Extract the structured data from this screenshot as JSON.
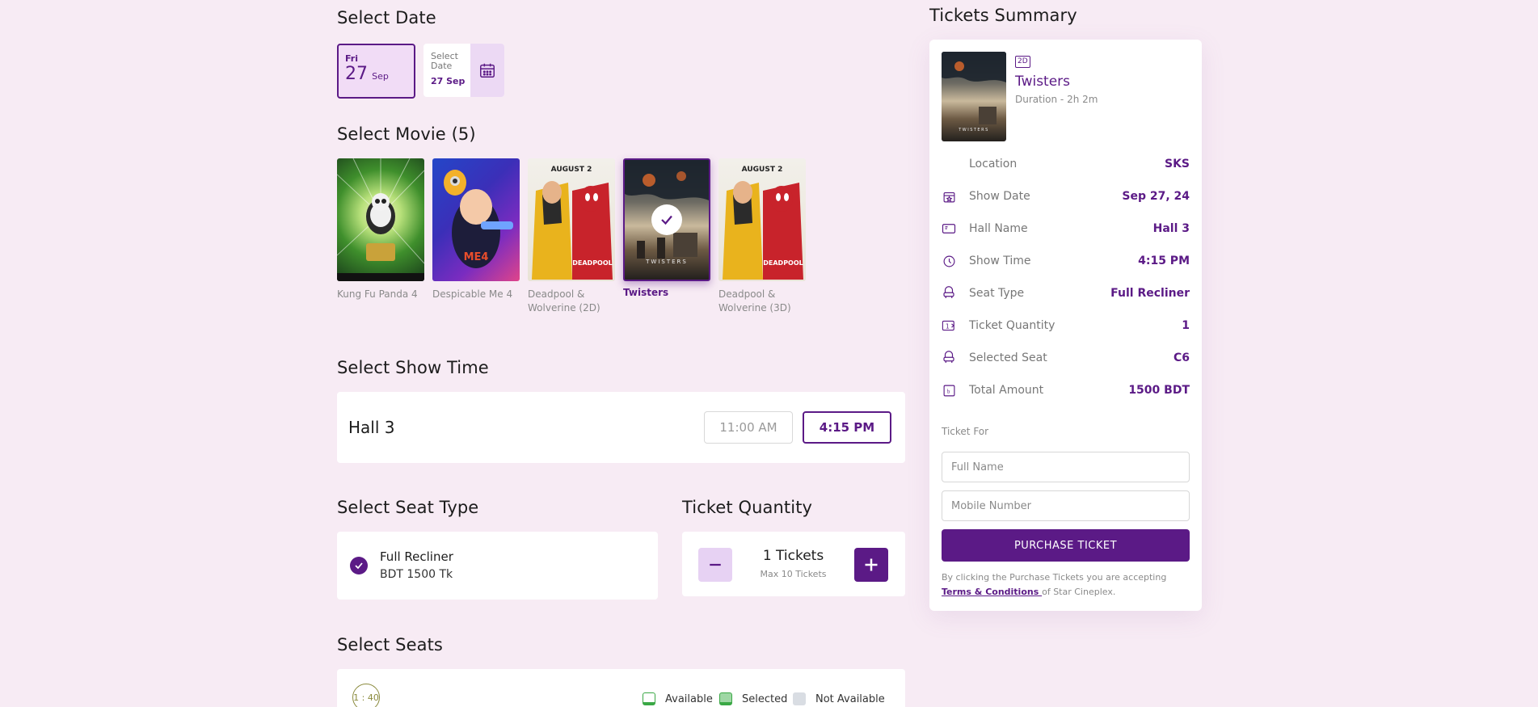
{
  "date_section": {
    "title": "Select Date",
    "selected": {
      "dow": "Fri",
      "day": "27",
      "month": "Sep"
    },
    "picker": {
      "label": "Select Date",
      "value": "27 Sep",
      "icon": "calendar-icon"
    }
  },
  "movie_section": {
    "title": "Select Movie (5)",
    "movies": [
      {
        "name": "Kung Fu Panda 4"
      },
      {
        "name": "Despicable Me 4"
      },
      {
        "name": "Deadpool & Wolverine (2D)"
      },
      {
        "name": "Twisters"
      },
      {
        "name": "Deadpool & Wolverine (3D)"
      }
    ],
    "selected_movie": "Twisters"
  },
  "showtime_section": {
    "title": "Select Show Time",
    "hall": "Hall 3",
    "times": [
      "11:00 AM",
      "4:15 PM"
    ],
    "selected_time": "4:15 PM"
  },
  "seat_type_section": {
    "title": "Select Seat Type",
    "name": "Full Recliner",
    "price": "BDT 1500 Tk"
  },
  "quantity_section": {
    "title": "Ticket Quantity",
    "value": "1 Tickets",
    "max": "Max 10 Tickets"
  },
  "seats_section": {
    "title": "Select Seats",
    "timer": "1 : 40",
    "legend": [
      {
        "label": "Available",
        "color": "#3aa845"
      },
      {
        "label": "Selected",
        "color": "#3aa845"
      },
      {
        "label": "Not Available",
        "color": "#d9dde3"
      }
    ]
  },
  "summary": {
    "title": "Tickets Summary",
    "format_badge": "2D",
    "movie_title": "Twisters",
    "duration": "Duration - 2h 2m",
    "rows": [
      {
        "label": "Location",
        "value": "SKS",
        "icon": "location-icon"
      },
      {
        "label": "Show Date",
        "value": "Sep 27, 24",
        "icon": "calendar-icon"
      },
      {
        "label": "Hall Name",
        "value": "Hall 3",
        "icon": "ticket-icon"
      },
      {
        "label": "Show Time",
        "value": "4:15 PM",
        "icon": "clock-icon"
      },
      {
        "label": "Seat Type",
        "value": "Full Recliner",
        "icon": "seat-icon"
      },
      {
        "label": "Ticket Quantity",
        "value": "1",
        "icon": "quantity-icon"
      },
      {
        "label": "Selected Seat",
        "value": "C6",
        "icon": "seat-icon"
      },
      {
        "label": "Total Amount",
        "value": "1500 BDT",
        "icon": "taka-icon"
      }
    ],
    "ticket_for": "Ticket For",
    "full_name_placeholder": "Full Name",
    "mobile_placeholder": "Mobile Number",
    "purchase_label": "PURCHASE TICKET",
    "terms_prefix": "By clicking the Purchase Tickets you are accepting",
    "terms_link": " Terms & Conditions ",
    "terms_suffix": "of Star Cineplex."
  },
  "colors": {
    "accent": "#5b1a86",
    "background": "#f7ebf4"
  }
}
